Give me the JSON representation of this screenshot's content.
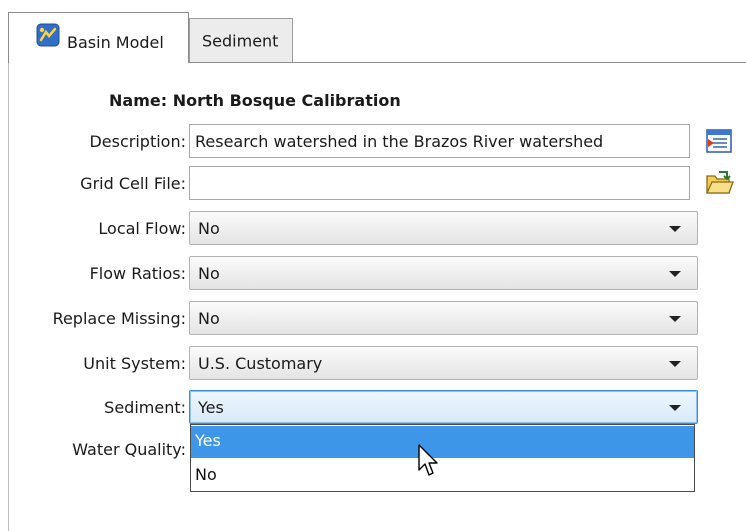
{
  "tabs": [
    {
      "label": "Basin Model",
      "icon": "basin-model-icon",
      "selected": true
    },
    {
      "label": "Sediment",
      "icon": "",
      "selected": false
    }
  ],
  "form": {
    "name_label": "Name:",
    "name_value": "North Bosque Calibration",
    "description_label": "Description:",
    "description_value": "Research watershed in the Brazos River watershed",
    "grid_cell_label": "Grid Cell File:",
    "grid_cell_value": "",
    "local_flow_label": "Local Flow:",
    "local_flow_value": "No",
    "flow_ratios_label": "Flow Ratios:",
    "flow_ratios_value": "No",
    "replace_missing_label": "Replace Missing:",
    "replace_missing_value": "No",
    "unit_system_label": "Unit System:",
    "unit_system_value": "U.S. Customary",
    "sediment_label": "Sediment:",
    "sediment_value": "Yes",
    "water_quality_label": "Water Quality:"
  },
  "sediment_dropdown": {
    "options": [
      "Yes",
      "No"
    ],
    "highlighted": "Yes"
  },
  "icons": {
    "description_button": "edit-description-icon",
    "grid_cell_button": "open-folder-icon"
  },
  "colors": {
    "selection": "#3d96e8",
    "active_border": "#3c8ddb"
  }
}
